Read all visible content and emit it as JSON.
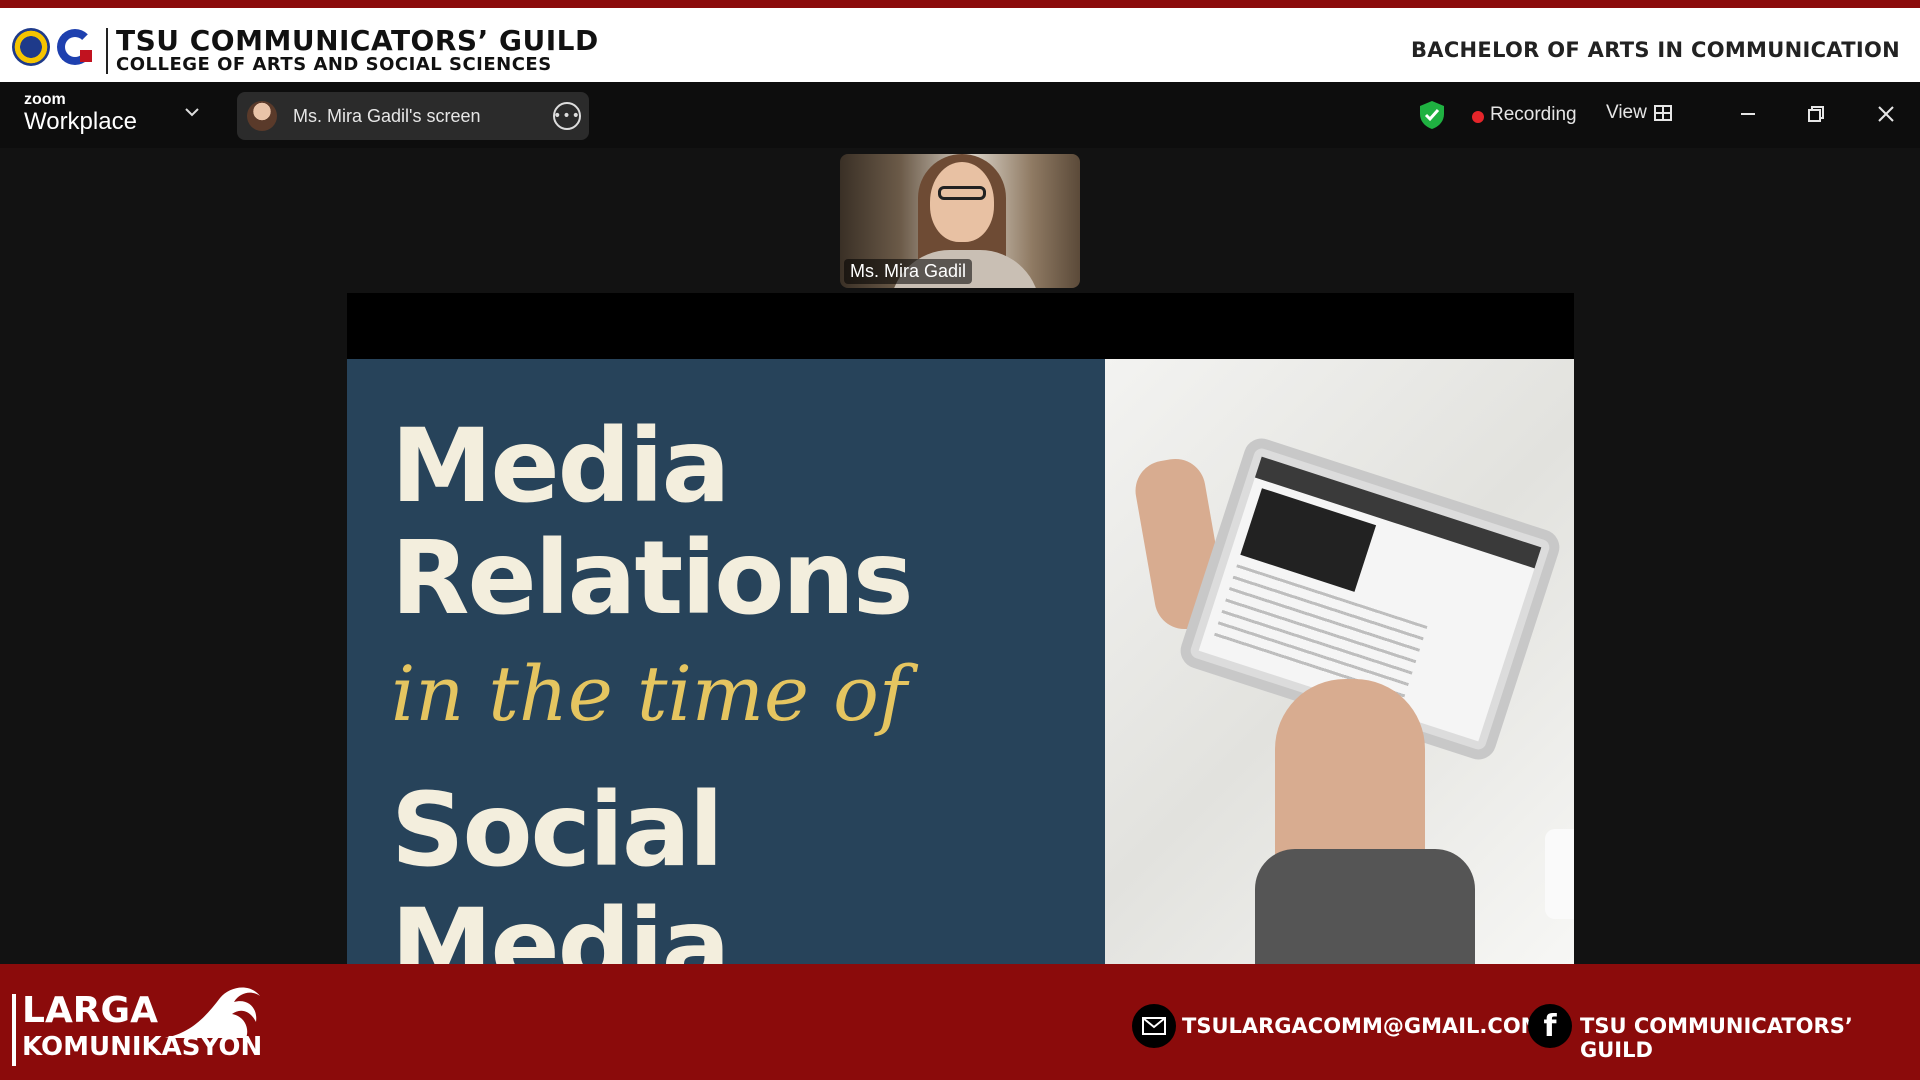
{
  "brand": {
    "title": "TSU COMMUNICATORS’ GUILD",
    "subtitle": "COLLEGE OF ARTS AND SOCIAL SCIENCES",
    "program": "BACHELOR OF ARTS IN COMMUNICATION",
    "accent": "#8b0b0b"
  },
  "zoom": {
    "logo_small": "zoom",
    "logo_big": "Workplace",
    "dropdown_icon": "chevron-down-icon",
    "screen_label": "Ms. Mira Gadil's screen",
    "more_icon": "more-options-icon",
    "security_icon": "shield-check-icon",
    "recording_label": "Recording",
    "recording_color": "#e5252a",
    "view_label": "View",
    "view_icon": "grid-icon",
    "window_controls": [
      "minimize-icon",
      "restore-icon",
      "close-icon"
    ]
  },
  "participant": {
    "name": "Ms. Mira Gadil"
  },
  "slide": {
    "line1": "Media",
    "line2": "Relations",
    "line3": "in the time of",
    "line4": "Social",
    "line5": "Media",
    "bg_color": "#27435a",
    "text_color": "#f3eedd",
    "accent_text_color": "#e5c560"
  },
  "footer": {
    "larga": "LARGA",
    "komunikasyon": "KOMUNIKASYON",
    "email": "TSULARGACOMM@GMAIL.COM",
    "facebook": "TSU COMMUNICATORS’ GUILD",
    "email_icon": "mail-icon",
    "facebook_icon": "facebook-icon"
  }
}
